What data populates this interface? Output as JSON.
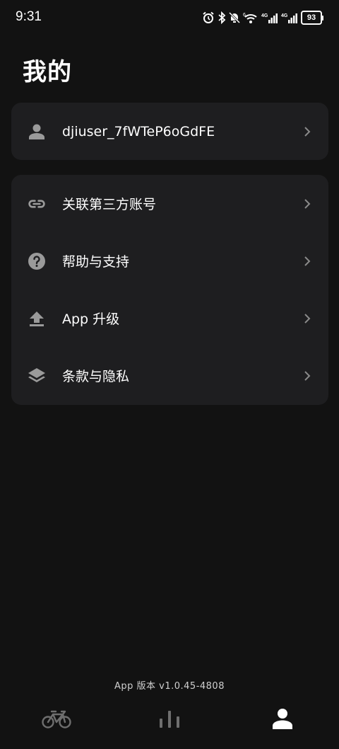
{
  "status_bar": {
    "time": "9:31",
    "battery": "93"
  },
  "page": {
    "title": "我的"
  },
  "user": {
    "username": "djiuser_7fWTeP6oGdFE"
  },
  "menu": {
    "items": [
      {
        "label": "关联第三方账号",
        "icon": "link-icon"
      },
      {
        "label": "帮助与支持",
        "icon": "help-icon"
      },
      {
        "label": "App 升级",
        "icon": "upgrade-icon"
      },
      {
        "label": "条款与隐私",
        "icon": "layers-icon"
      }
    ]
  },
  "footer": {
    "app_version": "App 版本 v1.0.45-4808"
  },
  "tabs": [
    {
      "name": "bike-tab",
      "icon": "bicycle-icon",
      "active": false
    },
    {
      "name": "stats-tab",
      "icon": "bar-chart-icon",
      "active": false
    },
    {
      "name": "profile-tab",
      "icon": "person-icon",
      "active": true
    }
  ],
  "colors": {
    "background": "#121212",
    "card": "#1e1e20",
    "icon_gray": "#9a9a9a",
    "tab_inactive": "#6e6e6e",
    "tab_active": "#ffffff"
  }
}
